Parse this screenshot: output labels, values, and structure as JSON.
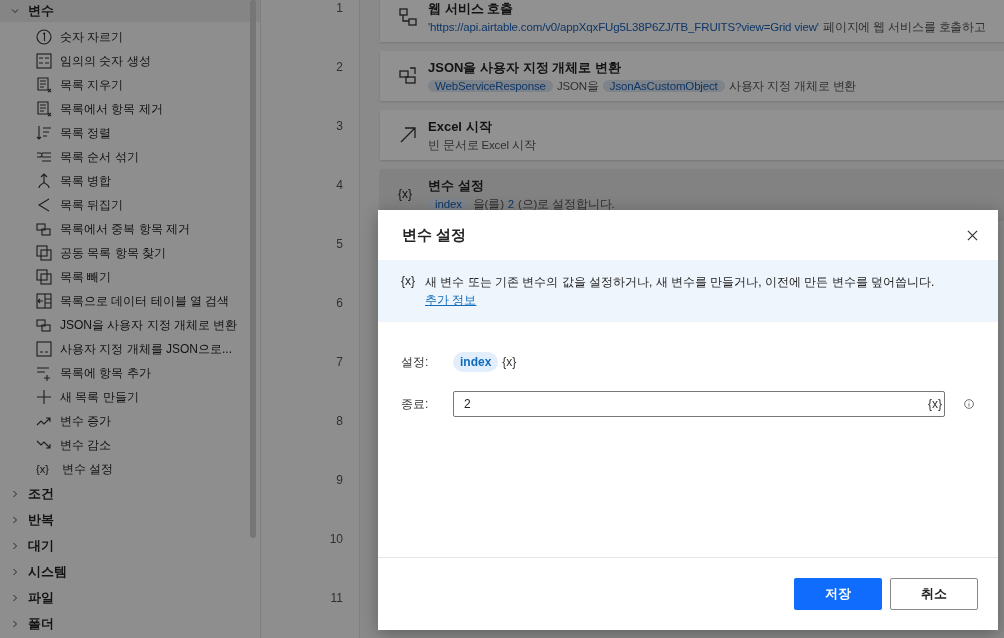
{
  "sidebar": {
    "groups": [
      {
        "label": "변수",
        "expanded": true,
        "items": [
          {
            "label": "숫자 자르기"
          },
          {
            "label": "임의의 숫자 생성"
          },
          {
            "label": "목록 지우기"
          },
          {
            "label": "목록에서 항목 제거"
          },
          {
            "label": "목록 정렬"
          },
          {
            "label": "목록 순서 섞기"
          },
          {
            "label": "목록 병합"
          },
          {
            "label": "목록 뒤집기"
          },
          {
            "label": "목록에서 중복 항목 제거"
          },
          {
            "label": "공동 목록 항목 찾기"
          },
          {
            "label": "목록 빼기"
          },
          {
            "label": "목록으로 데이터 테이블 열 검색"
          },
          {
            "label": "JSON을 사용자 지정 개체로 변환"
          },
          {
            "label": "사용자 지정 개체를 JSON으로..."
          },
          {
            "label": "목록에 항목 추가"
          },
          {
            "label": "새 목록 만들기"
          },
          {
            "label": "변수 증가"
          },
          {
            "label": "변수 감소"
          },
          {
            "label": "변수 설정",
            "icon_text": "{x}"
          }
        ]
      },
      {
        "label": "조건",
        "expanded": false
      },
      {
        "label": "반복",
        "expanded": false
      },
      {
        "label": "대기",
        "expanded": false
      },
      {
        "label": "시스템",
        "expanded": false
      },
      {
        "label": "파일",
        "expanded": false
      },
      {
        "label": "폴더",
        "expanded": false
      }
    ]
  },
  "line_numbers": [
    "1",
    "2",
    "3",
    "4",
    "5",
    "6",
    "7",
    "8",
    "9",
    "10",
    "11"
  ],
  "steps": [
    {
      "title": "웹 서비스 호출",
      "selected": false,
      "parts": [
        {
          "kind": "link",
          "text": "'https://api.airtable.com/v0/appXqxFUg5L38P6ZJ/TB_FRUITS?view=Grid view'"
        },
        {
          "kind": "text",
          "text": "페이지에 웹 서비스를 호출하고"
        }
      ]
    },
    {
      "title": "JSON을 사용자 지정 개체로 변환",
      "selected": false,
      "parts": [
        {
          "kind": "chip",
          "text": "WebServiceResponse"
        },
        {
          "kind": "text",
          "text": "JSON을"
        },
        {
          "kind": "chip",
          "text": "JsonAsCustomObject"
        },
        {
          "kind": "text",
          "text": "사용자 지정 개체로 변환"
        }
      ]
    },
    {
      "title": "Excel 시작",
      "selected": false,
      "parts": [
        {
          "kind": "text",
          "text": "빈 문서로 Excel 시작"
        }
      ]
    },
    {
      "title": "변수 설정",
      "icon_text": "{x}",
      "selected": true,
      "parts": [
        {
          "kind": "chip",
          "text": "index"
        },
        {
          "kind": "text",
          "text": "을(를)"
        },
        {
          "kind": "value",
          "text": "2"
        },
        {
          "kind": "text",
          "text": "(으)로 설정합니다."
        }
      ]
    }
  ],
  "dialog": {
    "title": "변수 설정",
    "info": {
      "icon_text": "{x}",
      "text": "새 변수 또는 기존 변수의 값을 설정하거나, 새 변수를 만들거나, 이전에 만든 변수를 덮어씁니다.",
      "link": "추가 정보"
    },
    "fields": [
      {
        "kind": "variable",
        "label": "설정:",
        "value": "index",
        "suffix": "{x}"
      },
      {
        "kind": "input",
        "label": "종료:",
        "value": "2",
        "suffix": "{x}"
      }
    ],
    "buttons": [
      {
        "label": "저장",
        "kind": "primary"
      },
      {
        "label": "취소",
        "kind": "secondary"
      }
    ]
  }
}
